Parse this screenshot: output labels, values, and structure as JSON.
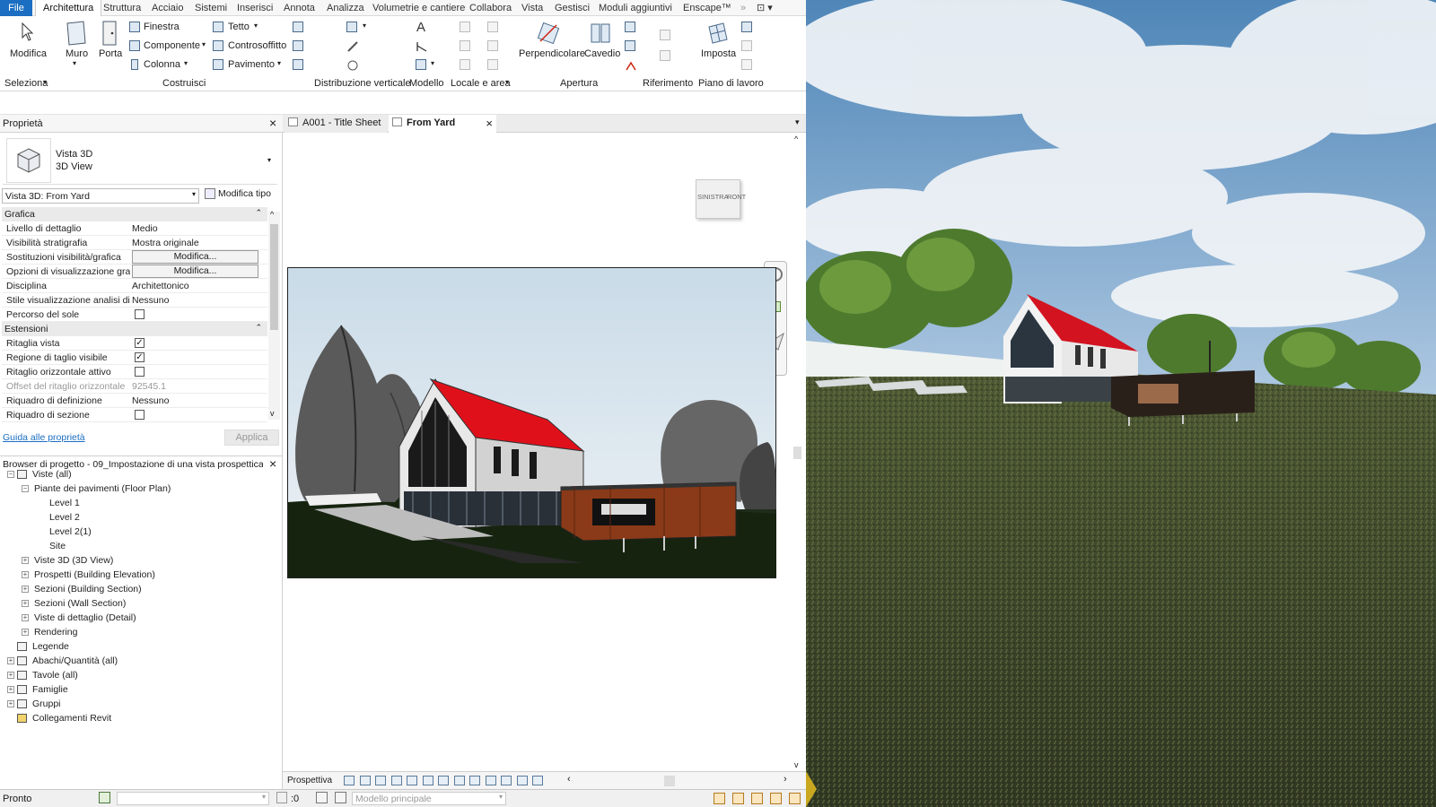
{
  "menubar": {
    "file": "File",
    "items": [
      "Architettura",
      "Struttura",
      "Acciaio",
      "Sistemi",
      "Inserisci",
      "Annota",
      "Analizza",
      "Volumetrie e cantiere",
      "Collabora",
      "Vista",
      "Gestisci",
      "Moduli aggiuntivi",
      "Enscape™"
    ]
  },
  "ribbon": {
    "modifica": "Modifica",
    "muro": "Muro",
    "porta": "Porta",
    "finestra": "Finestra",
    "componente": "Componente",
    "colonna": "Colonna",
    "tetto": "Tetto",
    "controsoffitto": "Controsoffitto",
    "pavimento": "Pavimento",
    "perpendicolare": "Perpendicolare",
    "cavedio": "Cavedio",
    "imposta": "Imposta",
    "groups": {
      "seleziona": "Seleziona",
      "costruisci": "Costruisci",
      "distribuzione": "Distribuzione verticale",
      "modello": "Modello",
      "locale": "Locale e area",
      "apertura": "Apertura",
      "riferimento": "Riferimento",
      "piano": "Piano di lavoro"
    }
  },
  "properties": {
    "title": "Proprietà",
    "type_name": "Vista 3D",
    "type_sub": "3D View",
    "selector": "Vista 3D: From Yard",
    "edit_type": "Modifica tipo",
    "sections": {
      "grafica": "Grafica",
      "estensioni": "Estensioni"
    },
    "rows_grafica": [
      {
        "k": "Livello di dettaglio",
        "v": "Medio",
        "kind": "text"
      },
      {
        "k": "Visibilità stratigrafia",
        "v": "Mostra originale",
        "kind": "text"
      },
      {
        "k": "Sostituzioni visibilità/grafica",
        "v": "Modifica...",
        "kind": "button"
      },
      {
        "k": "Opzioni di visualizzazione gra...",
        "v": "Modifica...",
        "kind": "button"
      },
      {
        "k": "Disciplina",
        "v": "Architettonico",
        "kind": "text"
      },
      {
        "k": "Stile visualizzazione analisi di ...",
        "v": "Nessuno",
        "kind": "text"
      },
      {
        "k": "Percorso del sole",
        "v": "",
        "kind": "check",
        "checked": false
      }
    ],
    "rows_estensioni": [
      {
        "k": "Ritaglia vista",
        "v": "",
        "kind": "check",
        "checked": true
      },
      {
        "k": "Regione di taglio visibile",
        "v": "",
        "kind": "check",
        "checked": true
      },
      {
        "k": "Ritaglio orizzontale attivo",
        "v": "",
        "kind": "check",
        "checked": false
      },
      {
        "k": "Offset del ritaglio orizzontale",
        "v": "92545.1",
        "kind": "grey"
      },
      {
        "k": "Riquadro di definizione",
        "v": "Nessuno",
        "kind": "text"
      },
      {
        "k": "Riquadro di sezione",
        "v": "",
        "kind": "check",
        "checked": false
      }
    ],
    "help_link": "Guida alle proprietà",
    "apply": "Applica"
  },
  "browser": {
    "title": "Browser di progetto - 09_Impostazione di una vista prospettica d...",
    "items": [
      {
        "t": "Viste (all)",
        "lvl": 0,
        "exp": "-",
        "icon": true
      },
      {
        "t": "Piante dei pavimenti (Floor Plan)",
        "lvl": 1,
        "exp": "-"
      },
      {
        "t": "Level 1",
        "lvl": 2,
        "exp": ""
      },
      {
        "t": "Level 2",
        "lvl": 2,
        "exp": ""
      },
      {
        "t": "Level 2(1)",
        "lvl": 2,
        "exp": ""
      },
      {
        "t": "Site",
        "lvl": 2,
        "exp": ""
      },
      {
        "t": "Viste 3D (3D View)",
        "lvl": 1,
        "exp": "+"
      },
      {
        "t": "Prospetti (Building Elevation)",
        "lvl": 1,
        "exp": "+"
      },
      {
        "t": "Sezioni (Building Section)",
        "lvl": 1,
        "exp": "+"
      },
      {
        "t": "Sezioni (Wall Section)",
        "lvl": 1,
        "exp": "+"
      },
      {
        "t": "Viste di dettaglio (Detail)",
        "lvl": 1,
        "exp": "+"
      },
      {
        "t": "Rendering",
        "lvl": 1,
        "exp": "+"
      },
      {
        "t": "Legende",
        "lvl": 0,
        "exp": "",
        "icon": true
      },
      {
        "t": "Abachi/Quantità (all)",
        "lvl": 0,
        "exp": "+",
        "icon": true
      },
      {
        "t": "Tavole (all)",
        "lvl": 0,
        "exp": "+",
        "icon": true
      },
      {
        "t": "Famiglie",
        "lvl": 0,
        "exp": "+",
        "icon": true
      },
      {
        "t": "Gruppi",
        "lvl": 0,
        "exp": "+",
        "icon": true
      },
      {
        "t": "Collegamenti Revit",
        "lvl": 0,
        "exp": "",
        "icon": true,
        "link": true
      }
    ]
  },
  "tabs": [
    {
      "label": "A001 - Title Sheet",
      "active": false
    },
    {
      "label": "From Yard",
      "active": true
    }
  ],
  "viewcube": {
    "left": "SINISTRA",
    "front": "RONT"
  },
  "viewbar": {
    "mode": "Prospettiva"
  },
  "status": {
    "text": "Pronto",
    "count": ":0",
    "model": "Modello principale"
  },
  "colors": {
    "accent": "#1b6ec2",
    "roof": "#e0101a",
    "cladding": "#8a3a18"
  }
}
